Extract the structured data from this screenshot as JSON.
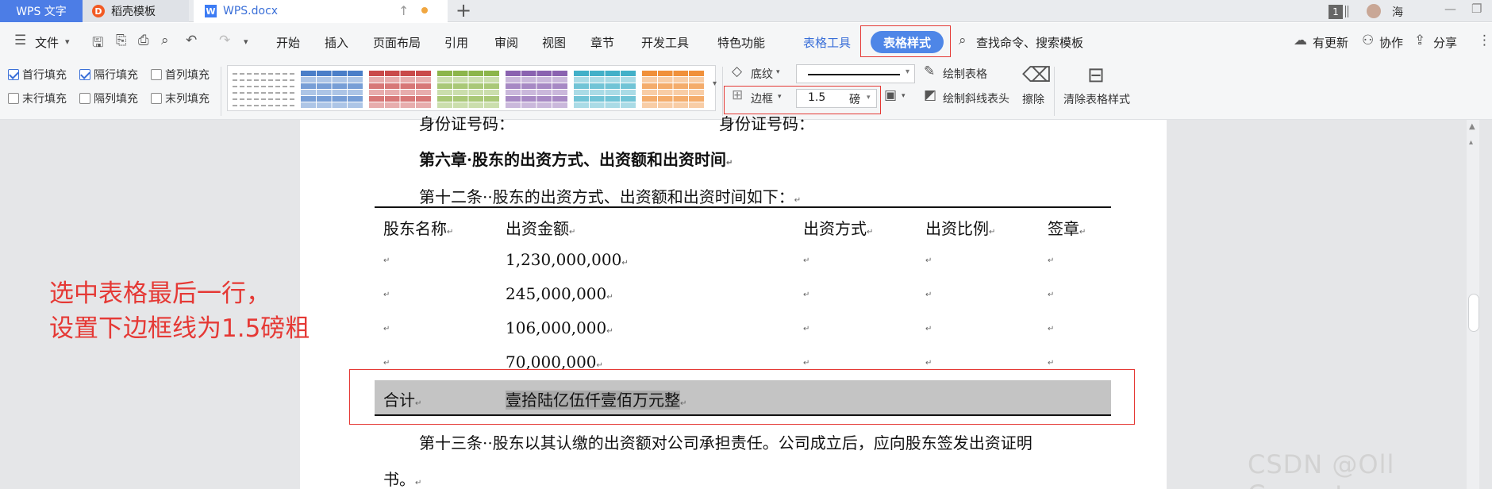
{
  "tabs": {
    "app": "WPS 文字",
    "templates": "稻壳模板",
    "document": "WPS.docx",
    "add_symbol": "+"
  },
  "titlebar": {
    "badge": "1",
    "user": "海"
  },
  "menu": {
    "file": "文件",
    "items": [
      "开始",
      "插入",
      "页面布局",
      "引用",
      "审阅",
      "视图",
      "章节",
      "开发工具",
      "特色功能"
    ],
    "table_tools": "表格工具",
    "table_style": "表格样式",
    "search": "查找命令、搜索模板",
    "update": "有更新",
    "collab": "协作",
    "share": "分享"
  },
  "ribbon": {
    "checks": [
      {
        "label": "首行填充",
        "checked": true
      },
      {
        "label": "隔行填充",
        "checked": true
      },
      {
        "label": "首列填充",
        "checked": false
      },
      {
        "label": "末行填充",
        "checked": false
      },
      {
        "label": "隔列填充",
        "checked": false
      },
      {
        "label": "末列填充",
        "checked": false
      }
    ],
    "shading": "底纹",
    "border": "边框",
    "line_width": "1.5",
    "line_unit": "磅",
    "draw_table": "绘制表格",
    "draw_diagonal": "绘制斜线表头",
    "erase": "擦除",
    "clear_style": "清除表格样式",
    "gallery_colors": [
      "#ffffff",
      "#4a7ec8",
      "#c94a4a",
      "#8cb54a",
      "#8a62b0",
      "#42b0c8",
      "#f0903a"
    ]
  },
  "document": {
    "id_line_left": "身份证号码：",
    "id_line_right": "身份证号码：",
    "chapter_num": "第六章",
    "chapter_title": "股东的出资方式、出资额和出资时间",
    "article12_num": "第十二条",
    "article12_text": "股东的出资方式、出资额和出资时间如下：",
    "table": {
      "headers": [
        "股东名称",
        "出资金额",
        "出资方式",
        "出资比例",
        "签章"
      ],
      "amounts": [
        "1,230,000,000",
        "245,000,000",
        "106,000,000",
        "70,000,000"
      ],
      "total_label": "合计",
      "total_value": "壹拾陆亿伍仟壹佰万元整"
    },
    "article13_num": "第十三条",
    "article13_text": "股东以其认缴的出资额对公司承担责任。公司成立后，应向股东签发出资证明",
    "article13_cont": "书。"
  },
  "annotation": [
    "选中表格最后一行，",
    "设置下边框线为1.5磅粗"
  ],
  "watermark": "CSDN @Oll Correct"
}
